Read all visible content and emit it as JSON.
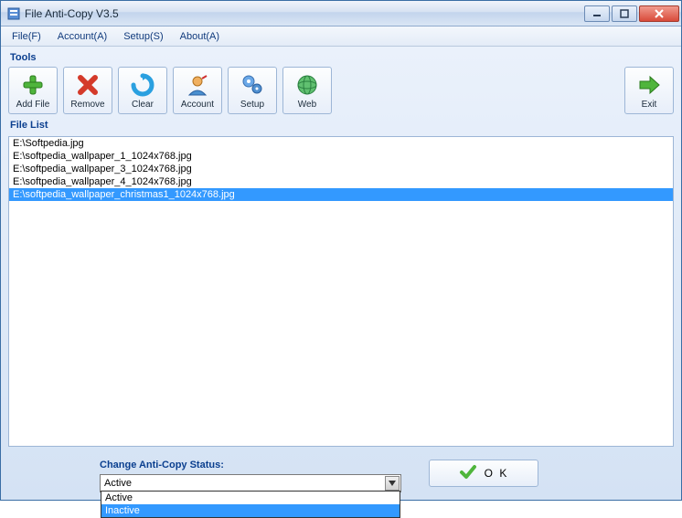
{
  "window": {
    "title": "File Anti-Copy V3.5"
  },
  "menu": {
    "file": "File(F)",
    "account": "Account(A)",
    "setup": "Setup(S)",
    "about": "About(A)"
  },
  "sections": {
    "tools": "Tools",
    "filelist": "File List"
  },
  "toolbar": {
    "addfile": "Add File",
    "remove": "Remove",
    "clear": "Clear",
    "account": "Account",
    "setup": "Setup",
    "web": "Web",
    "exit": "Exit"
  },
  "files": [
    {
      "path": "E:\\Softpedia.jpg",
      "selected": false
    },
    {
      "path": "E:\\softpedia_wallpaper_1_1024x768.jpg",
      "selected": false
    },
    {
      "path": "E:\\softpedia_wallpaper_3_1024x768.jpg",
      "selected": false
    },
    {
      "path": "E:\\softpedia_wallpaper_4_1024x768.jpg",
      "selected": false
    },
    {
      "path": "E:\\softpedia_wallpaper_christmas1_1024x768.jpg",
      "selected": true
    }
  ],
  "status": {
    "label": "Change Anti-Copy Status:",
    "value": "Active",
    "options": [
      "Active",
      "Inactive"
    ],
    "hoveredOption": "Inactive"
  },
  "ok": "O K"
}
